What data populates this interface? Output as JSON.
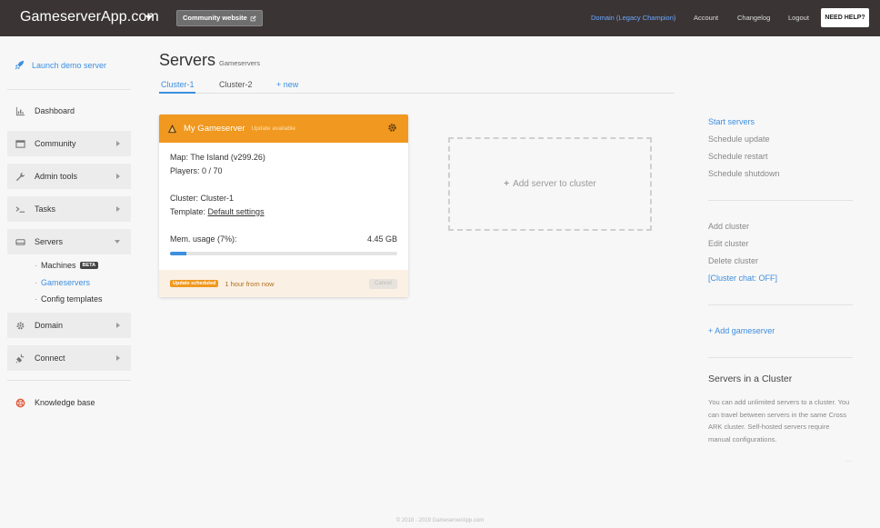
{
  "topbar": {
    "brand": "GameserverApp.com",
    "community_label": "Community website",
    "domain_label": "Domain (Legacy Champion)",
    "account_label": "Account",
    "changelog_label": "Changelog",
    "logout_label": "Logout",
    "help_label": "NEED HELP?"
  },
  "sidebar": {
    "launch_label": "Launch demo server",
    "items": [
      {
        "label": "Dashboard",
        "icon": "chart-icon"
      },
      {
        "label": "Community",
        "icon": "window-icon"
      },
      {
        "label": "Admin tools",
        "icon": "wrench-icon"
      },
      {
        "label": "Tasks",
        "icon": "terminal-icon"
      },
      {
        "label": "Servers",
        "icon": "server-icon"
      },
      {
        "label": "Domain",
        "icon": "gear-icon"
      },
      {
        "label": "Connect",
        "icon": "plug-icon"
      },
      {
        "label": "Knowledge base",
        "icon": "lifebuoy-icon"
      }
    ],
    "sub_items": [
      {
        "label": "Machines",
        "badge": "BETA"
      },
      {
        "label": "Gameservers"
      },
      {
        "label": "Config templates"
      }
    ]
  },
  "main": {
    "title": "Servers",
    "subtitle": "Gameservers",
    "tabs": [
      {
        "label": "Cluster-1"
      },
      {
        "label": "Cluster-2"
      },
      {
        "label": "+ new"
      }
    ]
  },
  "server_card": {
    "name": "My Gameserver",
    "status": "Update available",
    "map": "Map: The Island (v299.26)",
    "players": "Players: 0 / 70",
    "cluster": "Cluster: Cluster-1",
    "template_prefix": "Template: ",
    "template_link": "Default settings",
    "mem_label": "Mem. usage (7%):",
    "mem_value": "4.45 GB",
    "mem_percent": 7,
    "sched_badge": "Update scheduled",
    "sched_time": "1 hour from now",
    "cancel_label": "Cancel"
  },
  "add_server": {
    "label": "Add server to cluster"
  },
  "right_column": {
    "actions": [
      "Start servers",
      "Schedule update",
      "Schedule restart",
      "Schedule shutdown"
    ],
    "cluster_actions": [
      "Add cluster",
      "Edit cluster",
      "Delete cluster",
      "[Cluster chat: OFF]"
    ],
    "add_gameserver": "+ Add gameserver",
    "info_title": "Servers in a Cluster",
    "info_text": "You can add unlimited servers to a cluster. You can travel between servers in the same Cross ARK cluster. Self-hosted servers require manual configurations.",
    "dots": "...."
  },
  "footer": {
    "text": "© 2018 - 2019 GameserverApp.com"
  },
  "colors": {
    "accent": "#3d8fe0",
    "card_header": "#f0981f",
    "topbar": "#3b3435"
  }
}
